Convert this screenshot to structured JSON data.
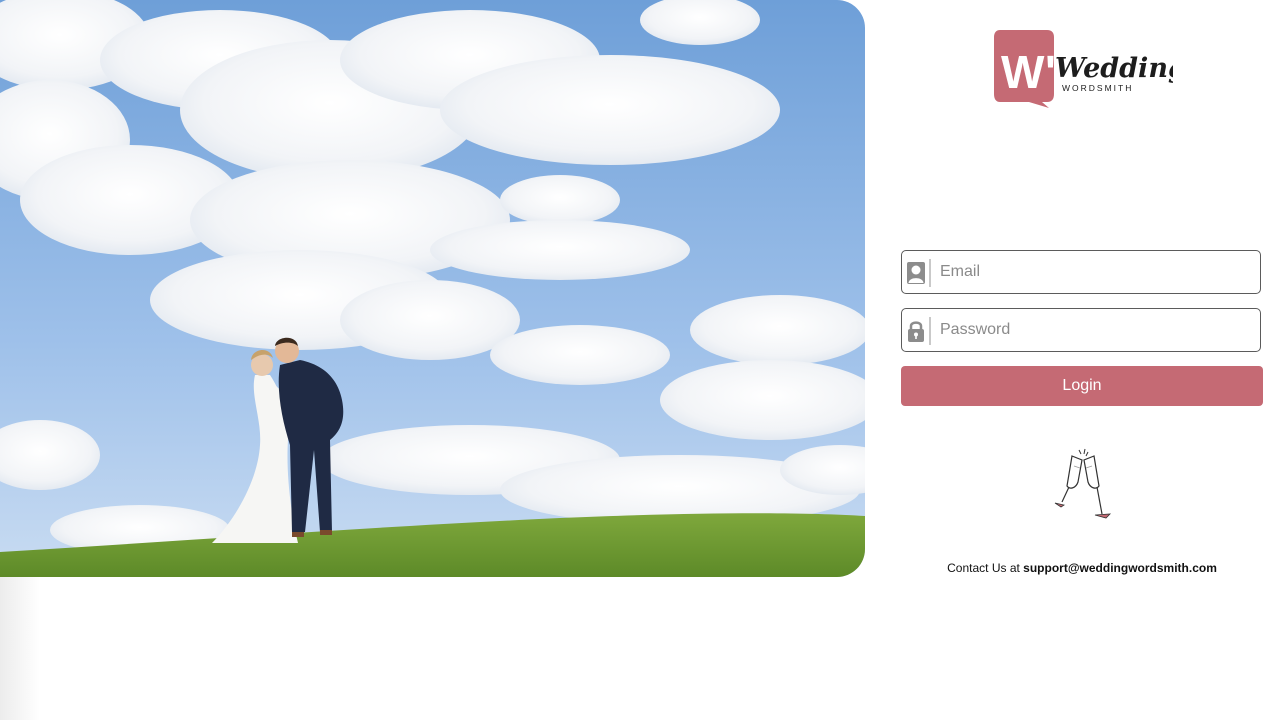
{
  "brand": {
    "logo_mark": "W\"",
    "logo_word": "Wedding",
    "logo_sub": "WORDSMITH",
    "accent_color": "#c56a74"
  },
  "hero": {
    "icon": "wedding-couple-photo"
  },
  "login": {
    "email_placeholder": "Email",
    "email_value": "",
    "email_icon": "user-icon",
    "password_placeholder": "Password",
    "password_value": "",
    "password_icon": "lock-icon",
    "button_label": "Login"
  },
  "decoration": {
    "icon": "champagne-toast-icon"
  },
  "contact": {
    "prefix": "Contact Us at",
    "email": "support@weddingwordsmith.com"
  }
}
